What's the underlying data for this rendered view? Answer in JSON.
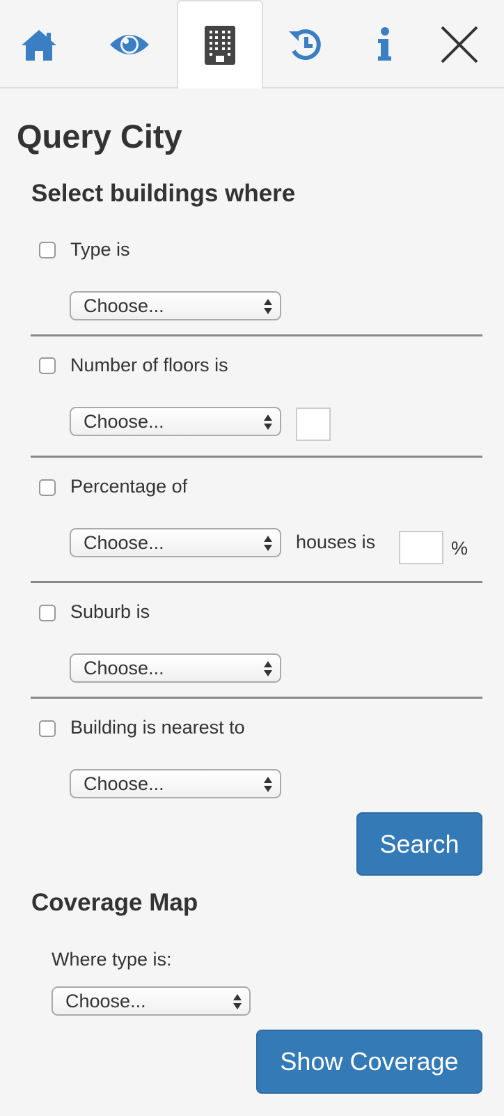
{
  "tabs": [
    {
      "icon": "home-icon"
    },
    {
      "icon": "eye-icon"
    },
    {
      "icon": "building-icon",
      "active": true
    },
    {
      "icon": "history-icon"
    },
    {
      "icon": "info-icon"
    },
    {
      "icon": "close-icon"
    }
  ],
  "colors": {
    "accent": "#337ab7",
    "icon_blue": "#3a7fc4",
    "active_icon": "#444444"
  },
  "page_title": "Query City",
  "query_heading": "Select buildings where",
  "filters": {
    "type": {
      "label": "Type is",
      "select": "Choose..."
    },
    "floors": {
      "label": "Number of floors is",
      "select": "Choose...",
      "value": ""
    },
    "percentage": {
      "label": "Percentage of",
      "select": "Choose...",
      "middle": "houses is",
      "value": "",
      "unit": "%"
    },
    "suburb": {
      "label": "Suburb is",
      "select": "Choose..."
    },
    "nearest": {
      "label": "Building is nearest to",
      "select": "Choose..."
    }
  },
  "search_button": "Search",
  "coverage": {
    "heading": "Coverage Map",
    "label": "Where type is:",
    "select": "Choose...",
    "button": "Show Coverage"
  }
}
